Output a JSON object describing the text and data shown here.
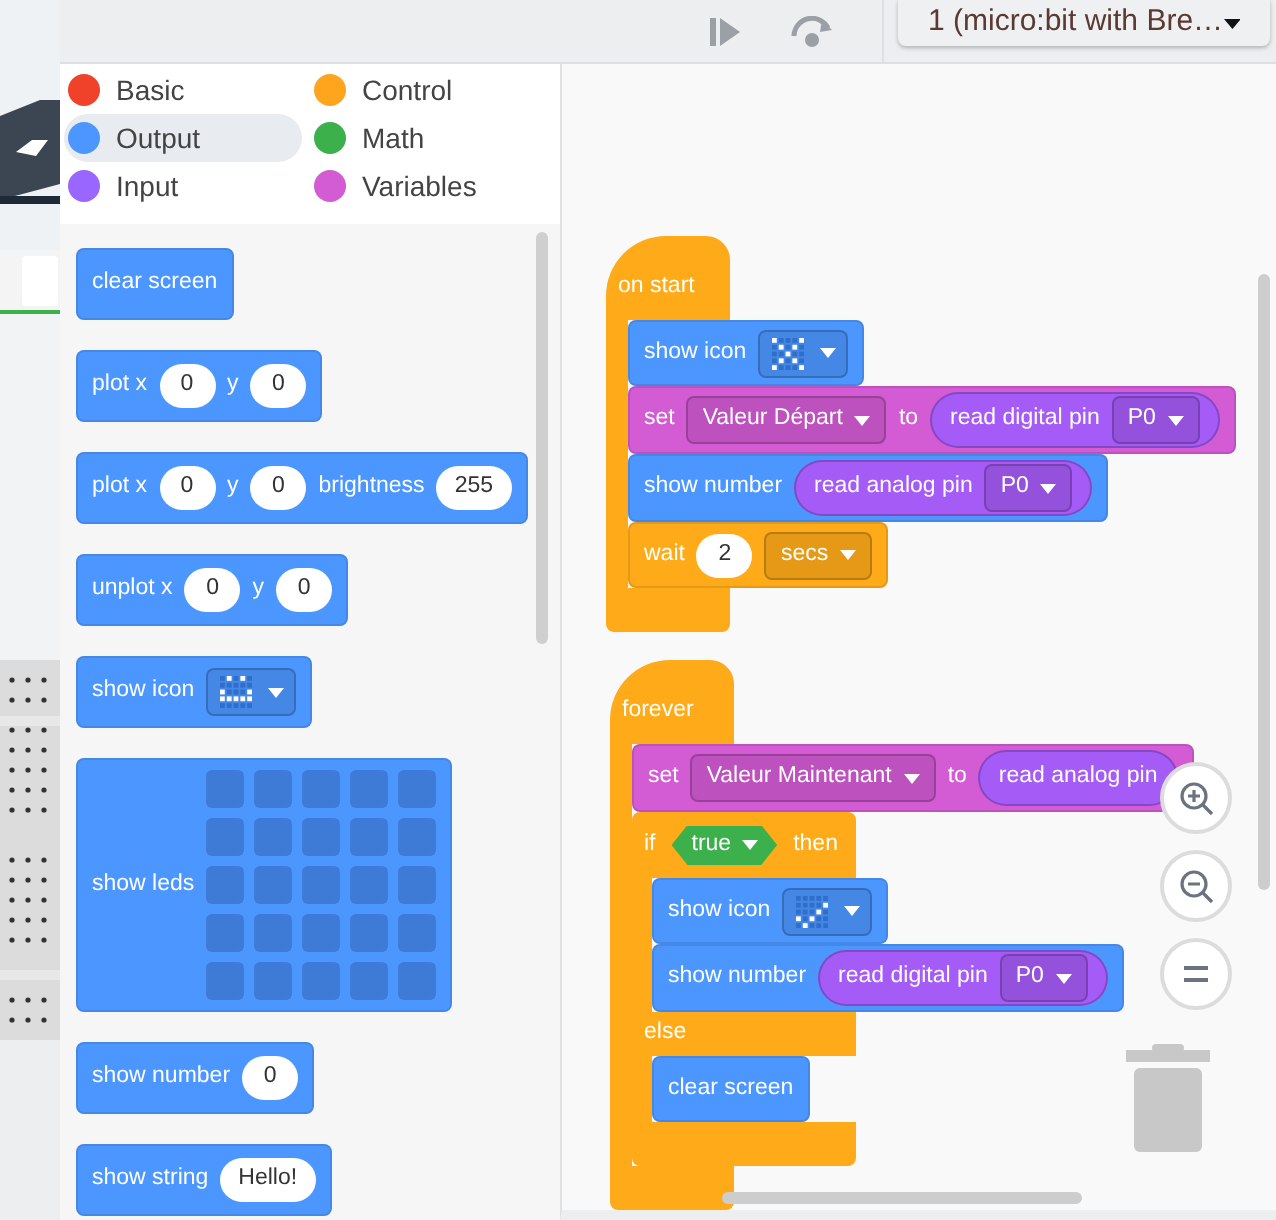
{
  "toolbar": {
    "device_dropdown": "1 (micro:bit with Bre…"
  },
  "categories": [
    {
      "label": "Basic",
      "color": "#f0412a",
      "selected": false
    },
    {
      "label": "Control",
      "color": "#ffa51d",
      "selected": false
    },
    {
      "label": "Output",
      "color": "#4c97ff",
      "selected": true
    },
    {
      "label": "Math",
      "color": "#3cb04a",
      "selected": false
    },
    {
      "label": "Input",
      "color": "#9966ff",
      "selected": false
    },
    {
      "label": "Variables",
      "color": "#d35bd3",
      "selected": false
    }
  ],
  "toolbox_blocks": [
    {
      "kind": "statement",
      "color": "#4c97ff",
      "parts": [
        {
          "kind": "label",
          "text": "clear screen"
        }
      ]
    },
    {
      "kind": "statement",
      "color": "#4c97ff",
      "parts": [
        {
          "kind": "label",
          "text": "plot x"
        },
        {
          "kind": "number",
          "text": "0"
        },
        {
          "kind": "label",
          "text": "y"
        },
        {
          "kind": "number",
          "text": "0"
        }
      ]
    },
    {
      "kind": "statement",
      "color": "#4c97ff",
      "parts": [
        {
          "kind": "label",
          "text": "plot x"
        },
        {
          "kind": "number",
          "text": "0"
        },
        {
          "kind": "label",
          "text": "y"
        },
        {
          "kind": "number",
          "text": "0"
        },
        {
          "kind": "label",
          "text": "brightness"
        },
        {
          "kind": "number",
          "text": "255"
        }
      ]
    },
    {
      "kind": "statement",
      "color": "#4c97ff",
      "parts": [
        {
          "kind": "label",
          "text": "unplot x"
        },
        {
          "kind": "number",
          "text": "0"
        },
        {
          "kind": "label",
          "text": "y"
        },
        {
          "kind": "number",
          "text": "0"
        }
      ]
    },
    {
      "kind": "statement",
      "color": "#4c97ff",
      "parts": [
        {
          "kind": "label",
          "text": "show icon"
        },
        {
          "kind": "icon",
          "leds": [
            [
              false,
              true,
              false,
              true,
              false
            ],
            [
              false,
              false,
              false,
              false,
              false
            ],
            [
              true,
              false,
              false,
              false,
              true
            ],
            [
              true,
              true,
              true,
              true,
              true
            ],
            [
              false,
              false,
              false,
              false,
              false
            ]
          ]
        }
      ]
    },
    {
      "kind": "statement",
      "color": "#4c97ff",
      "parts": [
        {
          "kind": "label",
          "text": "show leds"
        },
        {
          "kind": "led_grid"
        }
      ]
    },
    {
      "kind": "statement",
      "color": "#4c97ff",
      "parts": [
        {
          "kind": "label",
          "text": "show number"
        },
        {
          "kind": "number",
          "text": "0"
        }
      ]
    },
    {
      "kind": "statement",
      "color": "#4c97ff",
      "parts": [
        {
          "kind": "label",
          "text": "show string"
        },
        {
          "kind": "number",
          "text": "Hello!"
        }
      ]
    }
  ],
  "scripts": [
    {
      "hat": "on start",
      "body": [
        {
          "kind": "statement",
          "color": "#4c97ff",
          "parts": [
            {
              "kind": "label",
              "text": "show icon"
            },
            {
              "kind": "icon",
              "leds": [
                [
                  true,
                  false,
                  false,
                  false,
                  true
                ],
                [
                  false,
                  true,
                  false,
                  true,
                  false
                ],
                [
                  false,
                  false,
                  true,
                  false,
                  false
                ],
                [
                  false,
                  true,
                  false,
                  true,
                  false
                ],
                [
                  true,
                  false,
                  false,
                  false,
                  true
                ]
              ]
            }
          ]
        },
        {
          "kind": "statement",
          "color": "#d35bd3",
          "parts": [
            {
              "kind": "label",
              "text": "set"
            },
            {
              "kind": "dropdown",
              "text": "Valeur Départ"
            },
            {
              "kind": "label",
              "text": "to"
            },
            {
              "kind": "reporter",
              "color": "#a55bf5",
              "parts": [
                {
                  "kind": "label",
                  "text": "read digital pin"
                },
                {
                  "kind": "dropdown",
                  "text": "P0"
                }
              ]
            }
          ]
        },
        {
          "kind": "statement",
          "color": "#4c97ff",
          "parts": [
            {
              "kind": "label",
              "text": "show number"
            },
            {
              "kind": "reporter",
              "color": "#a55bf5",
              "parts": [
                {
                  "kind": "label",
                  "text": "read analog pin"
                },
                {
                  "kind": "dropdown",
                  "text": "P0"
                }
              ]
            }
          ]
        },
        {
          "kind": "statement",
          "color": "#ffab19",
          "parts": [
            {
              "kind": "label",
              "text": "wait"
            },
            {
              "kind": "number",
              "text": "2"
            },
            {
              "kind": "dropdown",
              "text": "secs"
            }
          ]
        }
      ]
    },
    {
      "hat": "forever",
      "body": [
        {
          "kind": "statement",
          "color": "#d35bd3",
          "parts": [
            {
              "kind": "label",
              "text": "set"
            },
            {
              "kind": "dropdown",
              "text": "Valeur Maintenant"
            },
            {
              "kind": "label",
              "text": "to"
            },
            {
              "kind": "reporter",
              "color": "#a55bf5",
              "parts": [
                {
                  "kind": "label",
                  "text": "read analog pin"
                }
              ]
            }
          ]
        },
        {
          "kind": "if",
          "color": "#ffab19",
          "parts": [
            {
              "kind": "label",
              "text": "if"
            },
            {
              "kind": "boolean",
              "color": "#3cb04a",
              "text": "true"
            },
            {
              "kind": "label",
              "text": "then"
            }
          ],
          "then": [
            {
              "kind": "statement",
              "color": "#4c97ff",
              "parts": [
                {
                  "kind": "label",
                  "text": "show icon"
                },
                {
                  "kind": "icon",
                  "leds": [
                    [
                      false,
                      false,
                      false,
                      false,
                      false
                    ],
                    [
                      false,
                      false,
                      false,
                      false,
                      true
                    ],
                    [
                      false,
                      false,
                      false,
                      true,
                      false
                    ],
                    [
                      true,
                      false,
                      true,
                      false,
                      false
                    ],
                    [
                      false,
                      true,
                      false,
                      false,
                      false
                    ]
                  ]
                }
              ]
            },
            {
              "kind": "statement",
              "color": "#4c97ff",
              "parts": [
                {
                  "kind": "label",
                  "text": "show number"
                },
                {
                  "kind": "reporter",
                  "color": "#a55bf5",
                  "parts": [
                    {
                      "kind": "label",
                      "text": "read digital pin"
                    },
                    {
                      "kind": "dropdown",
                      "text": "P0"
                    }
                  ]
                }
              ]
            }
          ],
          "else_label": "else",
          "else": [
            {
              "kind": "statement",
              "color": "#4c97ff",
              "parts": [
                {
                  "kind": "label",
                  "text": "clear screen"
                }
              ]
            }
          ]
        }
      ]
    }
  ]
}
